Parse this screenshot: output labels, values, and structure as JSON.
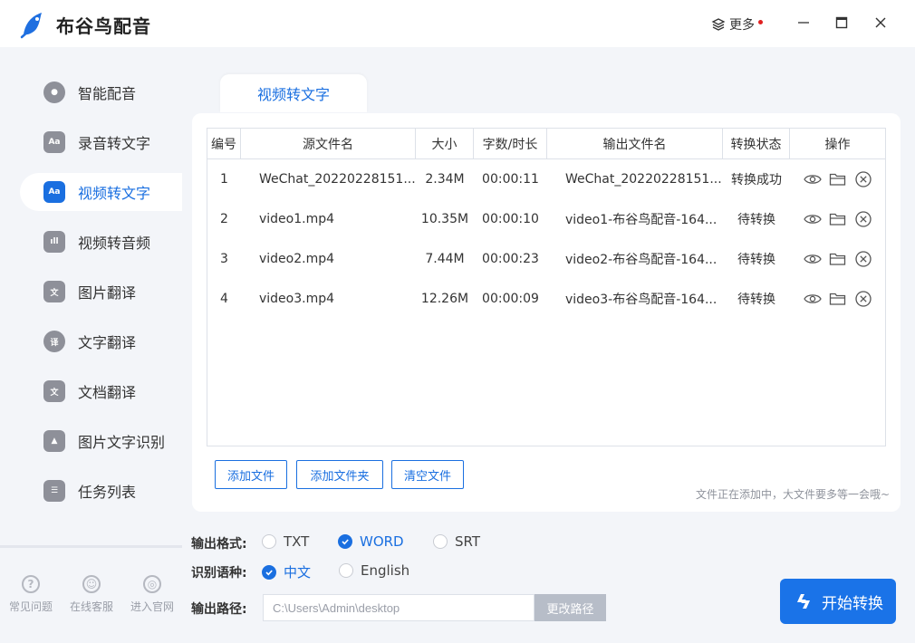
{
  "app": {
    "title": "布谷鸟配音"
  },
  "titlebar": {
    "more_label": "更多",
    "minimize": "—",
    "maximize": "□",
    "close": "✕"
  },
  "sidebar": {
    "items": [
      {
        "label": "智能配音",
        "icon": "microphone-icon"
      },
      {
        "label": "录音转文字",
        "icon": "audio-text-icon"
      },
      {
        "label": "视频转文字",
        "icon": "video-text-icon",
        "active": true
      },
      {
        "label": "视频转音频",
        "icon": "audio-wave-icon"
      },
      {
        "label": "图片翻译",
        "icon": "image-translate-icon"
      },
      {
        "label": "文字翻译",
        "icon": "text-translate-icon"
      },
      {
        "label": "文档翻译",
        "icon": "document-translate-icon"
      },
      {
        "label": "图片文字识别",
        "icon": "ocr-icon"
      },
      {
        "label": "任务列表",
        "icon": "task-list-icon"
      }
    ],
    "bottom": [
      {
        "label": "常见问题",
        "icon": "question-icon"
      },
      {
        "label": "在线客服",
        "icon": "support-icon"
      },
      {
        "label": "进入官网",
        "icon": "planet-icon"
      }
    ]
  },
  "main": {
    "tab_label": "视频转文字",
    "table": {
      "headers": [
        "编号",
        "源文件名",
        "大小",
        "字数/时长",
        "输出文件名",
        "转换状态",
        "操作"
      ],
      "rows": [
        {
          "no": "1",
          "source": "WeChat_20220228151...",
          "size": "2.34M",
          "duration": "00:00:11",
          "output": "WeChat_20220228151...",
          "status": "转换成功"
        },
        {
          "no": "2",
          "source": "video1.mp4",
          "size": "10.35M",
          "duration": "00:00:10",
          "output": "video1-布谷鸟配音-164...",
          "status": "待转换"
        },
        {
          "no": "3",
          "source": "video2.mp4",
          "size": "7.44M",
          "duration": "00:00:23",
          "output": "video2-布谷鸟配音-164...",
          "status": "待转换"
        },
        {
          "no": "4",
          "source": "video3.mp4",
          "size": "12.26M",
          "duration": "00:00:09",
          "output": "video3-布谷鸟配音-164...",
          "status": "待转换"
        }
      ]
    },
    "buttons": {
      "add_file": "添加文件",
      "add_folder": "添加文件夹",
      "clear": "清空文件"
    },
    "hint": "文件正在添加中，大文件要多等一会哦~"
  },
  "options": {
    "format_label": "输出格式:",
    "formats": [
      {
        "label": "TXT",
        "selected": false
      },
      {
        "label": "WORD",
        "selected": true
      },
      {
        "label": "SRT",
        "selected": false
      }
    ],
    "language_label": "识别语种:",
    "languages": [
      {
        "label": "中文",
        "selected": true
      },
      {
        "label": "English",
        "selected": false
      }
    ],
    "path_label": "输出路径:",
    "path_value": "C:\\Users\\Admin\\desktop",
    "path_button": "更改路径",
    "start_button": "开始转换"
  },
  "colors": {
    "accent": "#1a6fe0",
    "start_button": "#1a73e8",
    "badge": "#e02020"
  }
}
